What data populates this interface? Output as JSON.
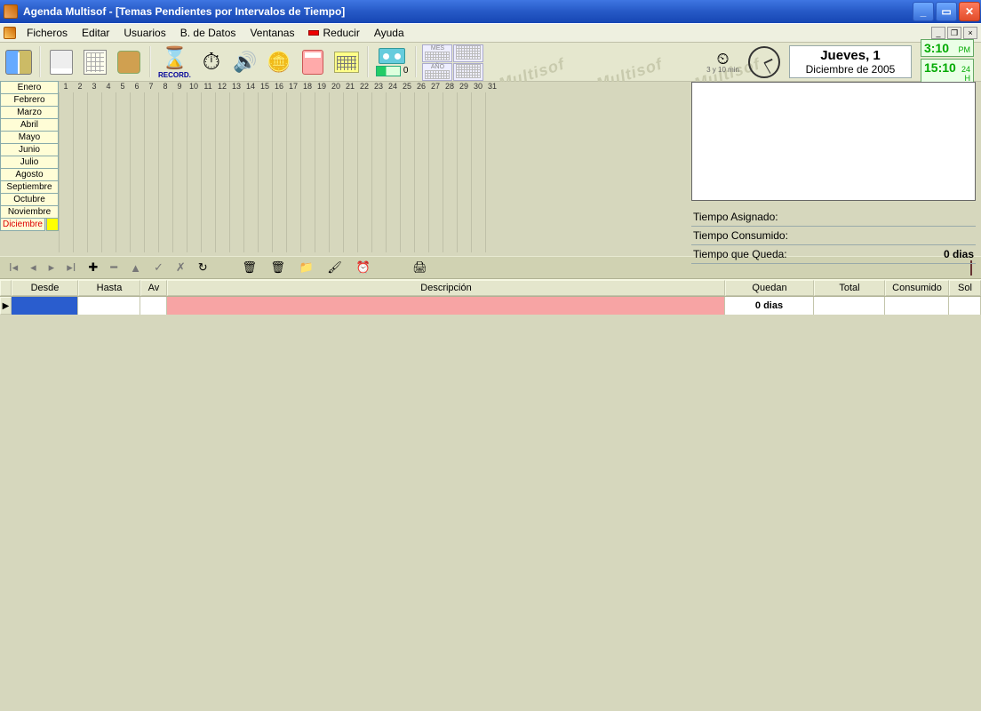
{
  "title": "Agenda Multisof - [Temas Pendientes por Intervalos de Tiempo]",
  "menu": {
    "ficheros": "Ficheros",
    "editar": "Editar",
    "usuarios": "Usuarios",
    "bdatos": "B. de Datos",
    "ventanas": "Ventanas",
    "reducir": "Reducir",
    "ayuda": "Ayuda"
  },
  "toolbar": {
    "record": "RECORD.",
    "prog_val": "0",
    "mini": {
      "mes": "MES",
      "ano": "AÑO"
    }
  },
  "datebox": {
    "line1": "Jueves, 1",
    "line2": "Diciembre de 2005",
    "t12": "3:10",
    "t12s": "PM",
    "t24": "15:10",
    "t24s": "24 H",
    "note": "3 y 10 min"
  },
  "months": [
    "Enero",
    "Febrero",
    "Marzo",
    "Abril",
    "Mayo",
    "Junio",
    "Julio",
    "Agosto",
    "Septiembre",
    "Octubre",
    "Noviembre",
    "Diciembre"
  ],
  "active_month_index": 11,
  "days": [
    "1",
    "2",
    "3",
    "4",
    "5",
    "6",
    "7",
    "8",
    "9",
    "10",
    "11",
    "12",
    "13",
    "14",
    "15",
    "16",
    "17",
    "18",
    "19",
    "20",
    "21",
    "22",
    "23",
    "24",
    "25",
    "26",
    "27",
    "28",
    "29",
    "30",
    "31"
  ],
  "stats": {
    "asignado_l": "Tiempo Asignado:",
    "asignado_v": "",
    "consumido_l": "Tiempo Consumido:",
    "consumido_v": "",
    "queda_l": "Tiempo que Queda:",
    "queda_v": "0 dias"
  },
  "cols": {
    "desde": "Desde",
    "hasta": "Hasta",
    "av": "Av",
    "desc": "Descripción",
    "quedan": "Quedan",
    "total": "Total",
    "cons": "Consumido",
    "sol": "Sol"
  },
  "row": {
    "desde": "",
    "hasta": "",
    "av": "",
    "desc": "",
    "quedan": "0 dias",
    "total": "",
    "cons": "",
    "sol": ""
  },
  "watermark": "Multisof"
}
